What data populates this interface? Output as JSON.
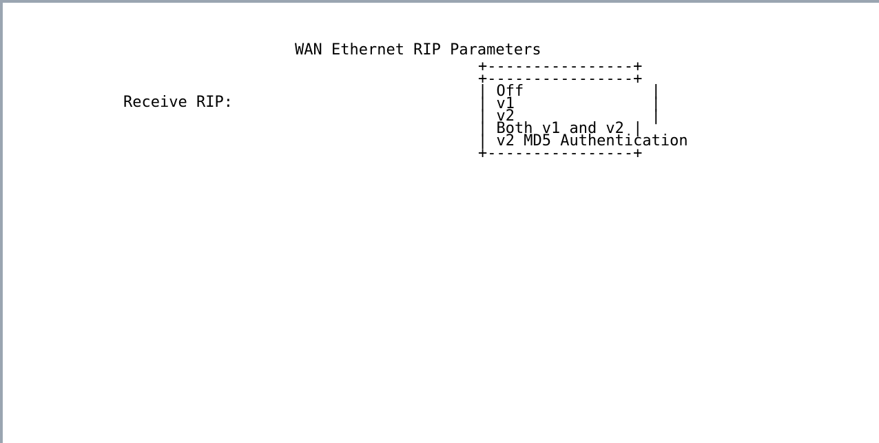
{
  "screen": {
    "title": "WAN Ethernet RIP Parameters",
    "field_label": "Receive RIP:"
  },
  "menu": {
    "border_top": "+----------------+",
    "border_sep": "+----------------+",
    "border_bottom": "+----------------+",
    "options": [
      "| Off              |",
      "| v1               |",
      "| v2               |",
      "| Both v1 and v2 |",
      "| v2 MD5 Authentication"
    ]
  },
  "colors": {
    "border": "#9aa5b1",
    "text": "#000000",
    "background": "#ffffff"
  }
}
